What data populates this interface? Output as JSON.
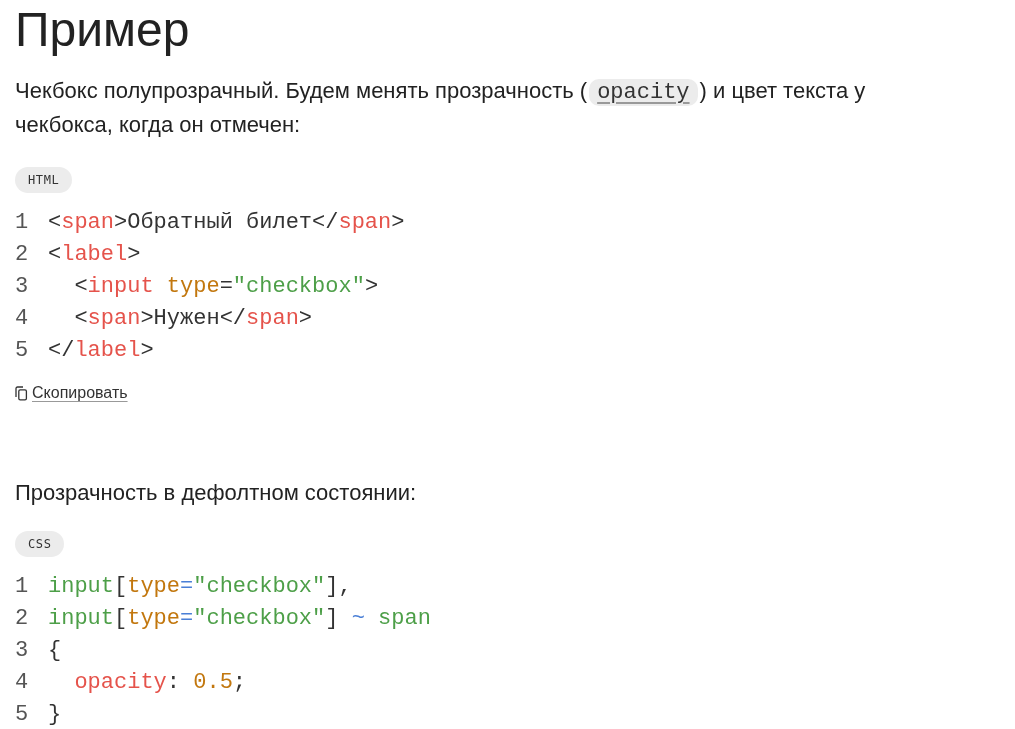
{
  "heading": "Пример",
  "intro": {
    "before": "Чекбокс полупрозрачный. Будем менять прозрачность (",
    "code": "opacity",
    "after": ") и цвет текста у чекбокса, когда он отмечен:"
  },
  "blocks": [
    {
      "lang": "HTML",
      "lines": [
        {
          "number": "1",
          "tokens": [
            {
              "kind": "punct",
              "text": "<"
            },
            {
              "kind": "tag",
              "text": "span"
            },
            {
              "kind": "punct",
              "text": ">Обратный билет</"
            },
            {
              "kind": "tag",
              "text": "span"
            },
            {
              "kind": "punct",
              "text": ">"
            }
          ]
        },
        {
          "number": "2",
          "tokens": [
            {
              "kind": "punct",
              "text": "<"
            },
            {
              "kind": "tag",
              "text": "label"
            },
            {
              "kind": "punct",
              "text": ">"
            }
          ]
        },
        {
          "number": "3",
          "tokens": [
            {
              "kind": "punct",
              "text": "  <"
            },
            {
              "kind": "tag",
              "text": "input"
            },
            {
              "kind": "attr",
              "text": " type"
            },
            {
              "kind": "punct",
              "text": "="
            },
            {
              "kind": "string",
              "text": "\"checkbox\""
            },
            {
              "kind": "punct",
              "text": ">"
            }
          ]
        },
        {
          "number": "4",
          "tokens": [
            {
              "kind": "punct",
              "text": "  <"
            },
            {
              "kind": "tag",
              "text": "span"
            },
            {
              "kind": "punct",
              "text": ">Нужен</"
            },
            {
              "kind": "tag",
              "text": "span"
            },
            {
              "kind": "punct",
              "text": ">"
            }
          ]
        },
        {
          "number": "5",
          "tokens": [
            {
              "kind": "punct",
              "text": "</"
            },
            {
              "kind": "tag",
              "text": "label"
            },
            {
              "kind": "punct",
              "text": ">"
            }
          ]
        }
      ],
      "copy": "Скопировать"
    },
    {
      "text_before": "Прозрачность в дефолтном состоянии:",
      "lang": "CSS",
      "lines": [
        {
          "number": "1",
          "tokens": [
            {
              "kind": "string",
              "text": "input"
            },
            {
              "kind": "punct",
              "text": "["
            },
            {
              "kind": "attr",
              "text": "type"
            },
            {
              "kind": "operator",
              "text": "="
            },
            {
              "kind": "string",
              "text": "\"checkbox\""
            },
            {
              "kind": "punct",
              "text": "],"
            }
          ]
        },
        {
          "number": "2",
          "tokens": [
            {
              "kind": "string",
              "text": "input"
            },
            {
              "kind": "punct",
              "text": "["
            },
            {
              "kind": "attr",
              "text": "type"
            },
            {
              "kind": "operator",
              "text": "="
            },
            {
              "kind": "string",
              "text": "\"checkbox\""
            },
            {
              "kind": "punct",
              "text": "] "
            },
            {
              "kind": "operator",
              "text": "~"
            },
            {
              "kind": "string",
              "text": " span"
            }
          ]
        },
        {
          "number": "3",
          "tokens": [
            {
              "kind": "punct",
              "text": "{"
            }
          ]
        },
        {
          "number": "4",
          "tokens": [
            {
              "kind": "tag",
              "text": "  opacity"
            },
            {
              "kind": "punct",
              "text": ": "
            },
            {
              "kind": "attr",
              "text": "0.5"
            },
            {
              "kind": "punct",
              "text": ";"
            }
          ]
        },
        {
          "number": "5",
          "tokens": [
            {
              "kind": "punct",
              "text": "}"
            }
          ]
        }
      ]
    }
  ]
}
